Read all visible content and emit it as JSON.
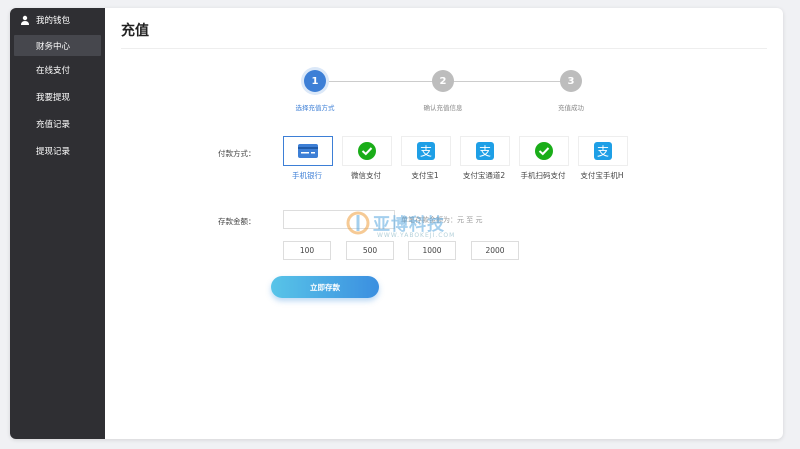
{
  "sidebar": {
    "header": "我的钱包",
    "items": [
      {
        "label": "财务中心",
        "active": true
      },
      {
        "label": "在线支付",
        "active": false
      },
      {
        "label": "我要提现",
        "active": false
      },
      {
        "label": "充值记录",
        "active": false
      },
      {
        "label": "提现记录",
        "active": false
      }
    ]
  },
  "page": {
    "title": "充值"
  },
  "steps": [
    {
      "num": "1",
      "label": "选择充值方式",
      "active": true
    },
    {
      "num": "2",
      "label": "确认充值信息",
      "active": false
    },
    {
      "num": "3",
      "label": "充值成功",
      "active": false
    }
  ],
  "payment": {
    "label": "付款方式：",
    "methods": [
      {
        "label": "手机银行",
        "icon": "bank-card-icon",
        "active": true
      },
      {
        "label": "微信支付",
        "icon": "wechat-icon",
        "active": false
      },
      {
        "label": "支付宝1",
        "icon": "alipay-icon",
        "active": false
      },
      {
        "label": "支付宝通道2",
        "icon": "alipay-icon",
        "active": false
      },
      {
        "label": "手机扫码支付",
        "icon": "wechat-icon",
        "active": false
      },
      {
        "label": "支付宝手机H",
        "icon": "alipay-icon",
        "active": false
      }
    ]
  },
  "amount": {
    "label": "存款金额：",
    "input_value": "",
    "range_text": "单笔存款金额为：元 至 元",
    "quick": [
      "100",
      "500",
      "1000",
      "2000"
    ]
  },
  "submit_label": "立即存款",
  "watermark": {
    "cn": "亚博科技",
    "en": "WWW.YABOKEJI.COM"
  },
  "colors": {
    "accent": "#3d7fd6",
    "wechat": "#1aad19",
    "alipay": "#1e9fe6",
    "sidebar": "#2f2f33"
  }
}
